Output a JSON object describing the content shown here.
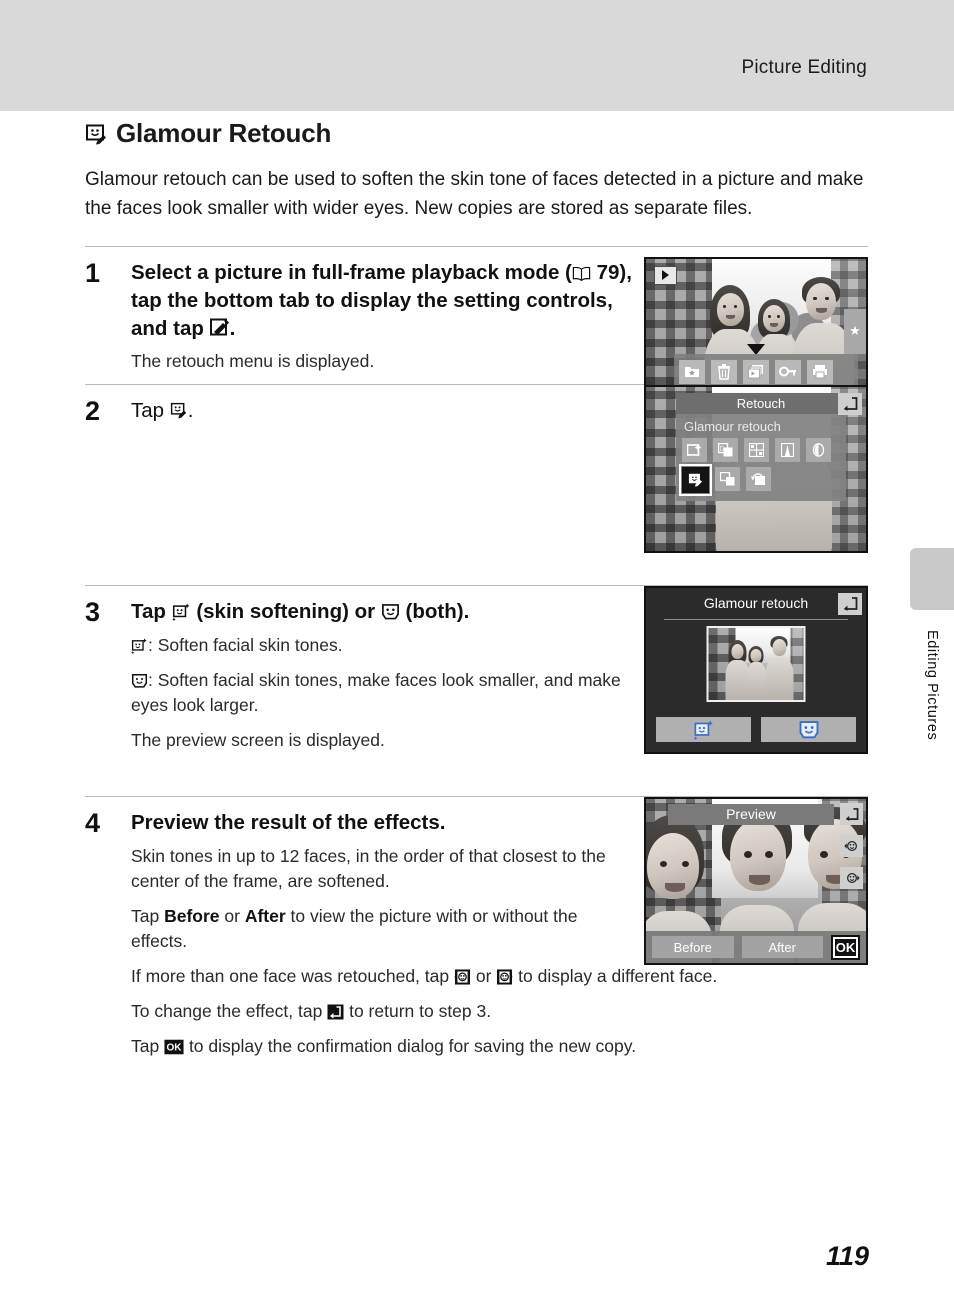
{
  "header": {
    "title": "Picture Editing"
  },
  "side_tab": {
    "label": "Editing Pictures"
  },
  "page": {
    "number": "119"
  },
  "chapter": {
    "icon": "glamour-retouch-icon",
    "title": "Glamour Retouch",
    "intro": "Glamour retouch can be used to soften the skin tone of faces detected in a picture and make the faces look smaller with wider eyes. New copies are stored as separate files."
  },
  "steps": [
    {
      "number": "1",
      "head_before": "Select a picture in full-frame playback mode (",
      "head_ref": " 79), tap the bottom tab to display the setting controls, and tap ",
      "head_after": ".",
      "body": [
        "The retouch menu is displayed."
      ],
      "screen": {
        "name": "full-frame-playback-with-controls",
        "controls_row1": [
          "favorites-icon",
          "delete-icon",
          "slideshow-icon",
          "protect-icon",
          "print-icon"
        ],
        "controls_row2": [
          "paint-icon",
          "retouch-icon",
          "voice-memo-icon",
          "setup-icon"
        ],
        "selected_control": "retouch-icon",
        "play_badge": "playback-icon",
        "side_tab_icon": "favorites-star-icon"
      }
    },
    {
      "number": "2",
      "head_before": "Tap ",
      "head_after": ".",
      "body": [],
      "screen": {
        "name": "retouch-menu",
        "title": "Retouch",
        "selected_label": "Glamour retouch",
        "row1": [
          "quick-retouch-icon",
          "d-lighting-icon",
          "filter-effects-icon",
          "perspective-icon",
          "skin-softening-icon"
        ],
        "row2": [
          "glamour-retouch-icon",
          "small-picture-icon",
          "rotate-image-icon"
        ],
        "selected_item": "glamour-retouch-icon",
        "back_icon": "back-icon"
      }
    },
    {
      "number": "3",
      "head_before": "Tap ",
      "head_mid": " (skin softening) or ",
      "head_after": " (both).",
      "body": [
        ": Soften facial skin tones.",
        ": Soften facial skin tones, make faces look smaller, and make eyes look larger.",
        "The preview screen is displayed."
      ],
      "screen": {
        "name": "glamour-retouch-select",
        "title": "Glamour retouch",
        "buttons": [
          "skin-softening-face-icon",
          "both-face-icon"
        ],
        "back_icon": "back-icon"
      }
    },
    {
      "number": "4",
      "head": "Preview the result of the effects.",
      "body": [
        "Skin tones in up to 12 faces, in the order of that closest to the center of the frame, are softened.",
        "Tap Before or After to view the picture with or without the effects.",
        "If more than one face was retouched, tap  or  to display a different face.",
        "To change the effect, tap  to return to step 3.",
        "Tap  to display the confirmation dialog for saving the new copy."
      ],
      "bold_terms": [
        "Before",
        "After"
      ],
      "screen": {
        "name": "preview-screen",
        "title": "Preview",
        "before_label": "Before",
        "after_label": "After",
        "ok_label": "OK",
        "back_icon": "back-icon",
        "side_icons": [
          "prev-face-icon",
          "next-face-icon"
        ]
      }
    }
  ],
  "colors": {
    "header_band": "#d9d9d9",
    "side_tab": "#c9c9c9",
    "rule": "#b9b9b9",
    "text": "#1a1a1a"
  }
}
